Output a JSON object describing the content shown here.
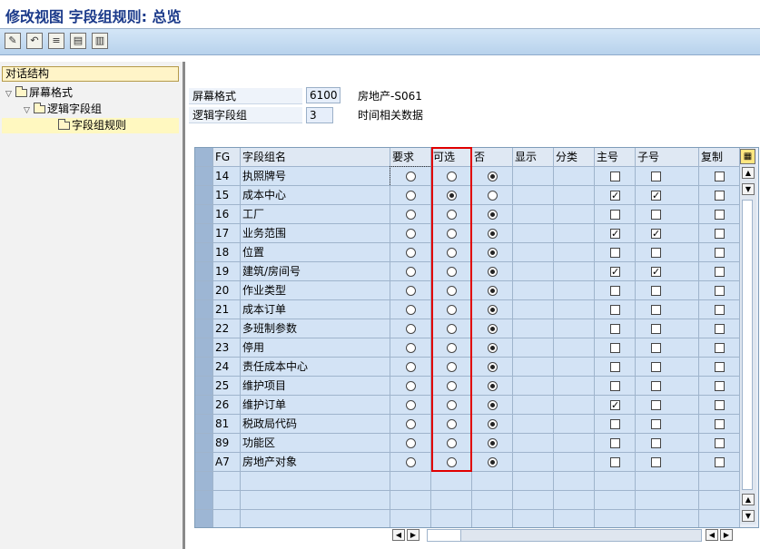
{
  "window": {
    "title": "修改视图 字段组规则: 总览"
  },
  "toolbar": {
    "buttons": [
      {
        "name": "edit-icon",
        "glyph": "✎"
      },
      {
        "name": "undo-icon",
        "glyph": "↶"
      },
      {
        "name": "list-icon",
        "glyph": "≡"
      },
      {
        "name": "select-all-icon",
        "glyph": "▤"
      },
      {
        "name": "deselect-icon",
        "glyph": "▥"
      }
    ]
  },
  "tree": {
    "header": "对话结构",
    "nodes": [
      {
        "label": "屏幕格式",
        "level": 0,
        "expanded": true
      },
      {
        "label": "逻辑字段组",
        "level": 1,
        "expanded": true
      },
      {
        "label": "字段组规则",
        "level": 2,
        "selected": true
      }
    ]
  },
  "header_fields": {
    "screen_format": {
      "label": "屏幕格式",
      "value": "6100",
      "description": "房地产-S061"
    },
    "logical_group": {
      "label": "逻辑字段组",
      "value": "3",
      "description": "时间相关数据"
    }
  },
  "table": {
    "columns": [
      "FG",
      "字段组名",
      "要求",
      "可选",
      "否",
      "显示",
      "分类",
      "主号",
      "子号",
      "复制"
    ],
    "rows": [
      {
        "fg": "14",
        "name": "执照牌号",
        "choice": "no",
        "main": false,
        "sub": false,
        "copy": false
      },
      {
        "fg": "15",
        "name": "成本中心",
        "choice": "optional",
        "main": true,
        "sub": true,
        "copy": false
      },
      {
        "fg": "16",
        "name": "工厂",
        "choice": "no",
        "main": false,
        "sub": false,
        "copy": false
      },
      {
        "fg": "17",
        "name": "业务范围",
        "choice": "no",
        "main": true,
        "sub": true,
        "copy": false
      },
      {
        "fg": "18",
        "name": "位置",
        "choice": "no",
        "main": false,
        "sub": false,
        "copy": false
      },
      {
        "fg": "19",
        "name": "建筑/房间号",
        "choice": "no",
        "main": true,
        "sub": true,
        "copy": false
      },
      {
        "fg": "20",
        "name": "作业类型",
        "choice": "no",
        "main": false,
        "sub": false,
        "copy": false
      },
      {
        "fg": "21",
        "name": "成本订单",
        "choice": "no",
        "main": false,
        "sub": false,
        "copy": false
      },
      {
        "fg": "22",
        "name": "多班制参数",
        "choice": "no",
        "main": false,
        "sub": false,
        "copy": false
      },
      {
        "fg": "23",
        "name": "停用",
        "choice": "no",
        "main": false,
        "sub": false,
        "copy": false
      },
      {
        "fg": "24",
        "name": "责任成本中心",
        "choice": "no",
        "main": false,
        "sub": false,
        "copy": false
      },
      {
        "fg": "25",
        "name": "维护项目",
        "choice": "no",
        "main": false,
        "sub": false,
        "copy": false
      },
      {
        "fg": "26",
        "name": "维护订单",
        "choice": "no",
        "main": true,
        "sub": false,
        "copy": false
      },
      {
        "fg": "81",
        "name": "税政局代码",
        "choice": "no",
        "main": false,
        "sub": false,
        "copy": false
      },
      {
        "fg": "89",
        "name": "功能区",
        "choice": "no",
        "main": false,
        "sub": false,
        "copy": false
      },
      {
        "fg": "A7",
        "name": "房地产对象",
        "choice": "no",
        "main": false,
        "sub": false,
        "copy": false
      }
    ],
    "empty_rows": 3
  },
  "colors": {
    "highlight_box": "#e00000",
    "row_bg": "#d3e3f5",
    "title_text": "#1b3a8a"
  }
}
